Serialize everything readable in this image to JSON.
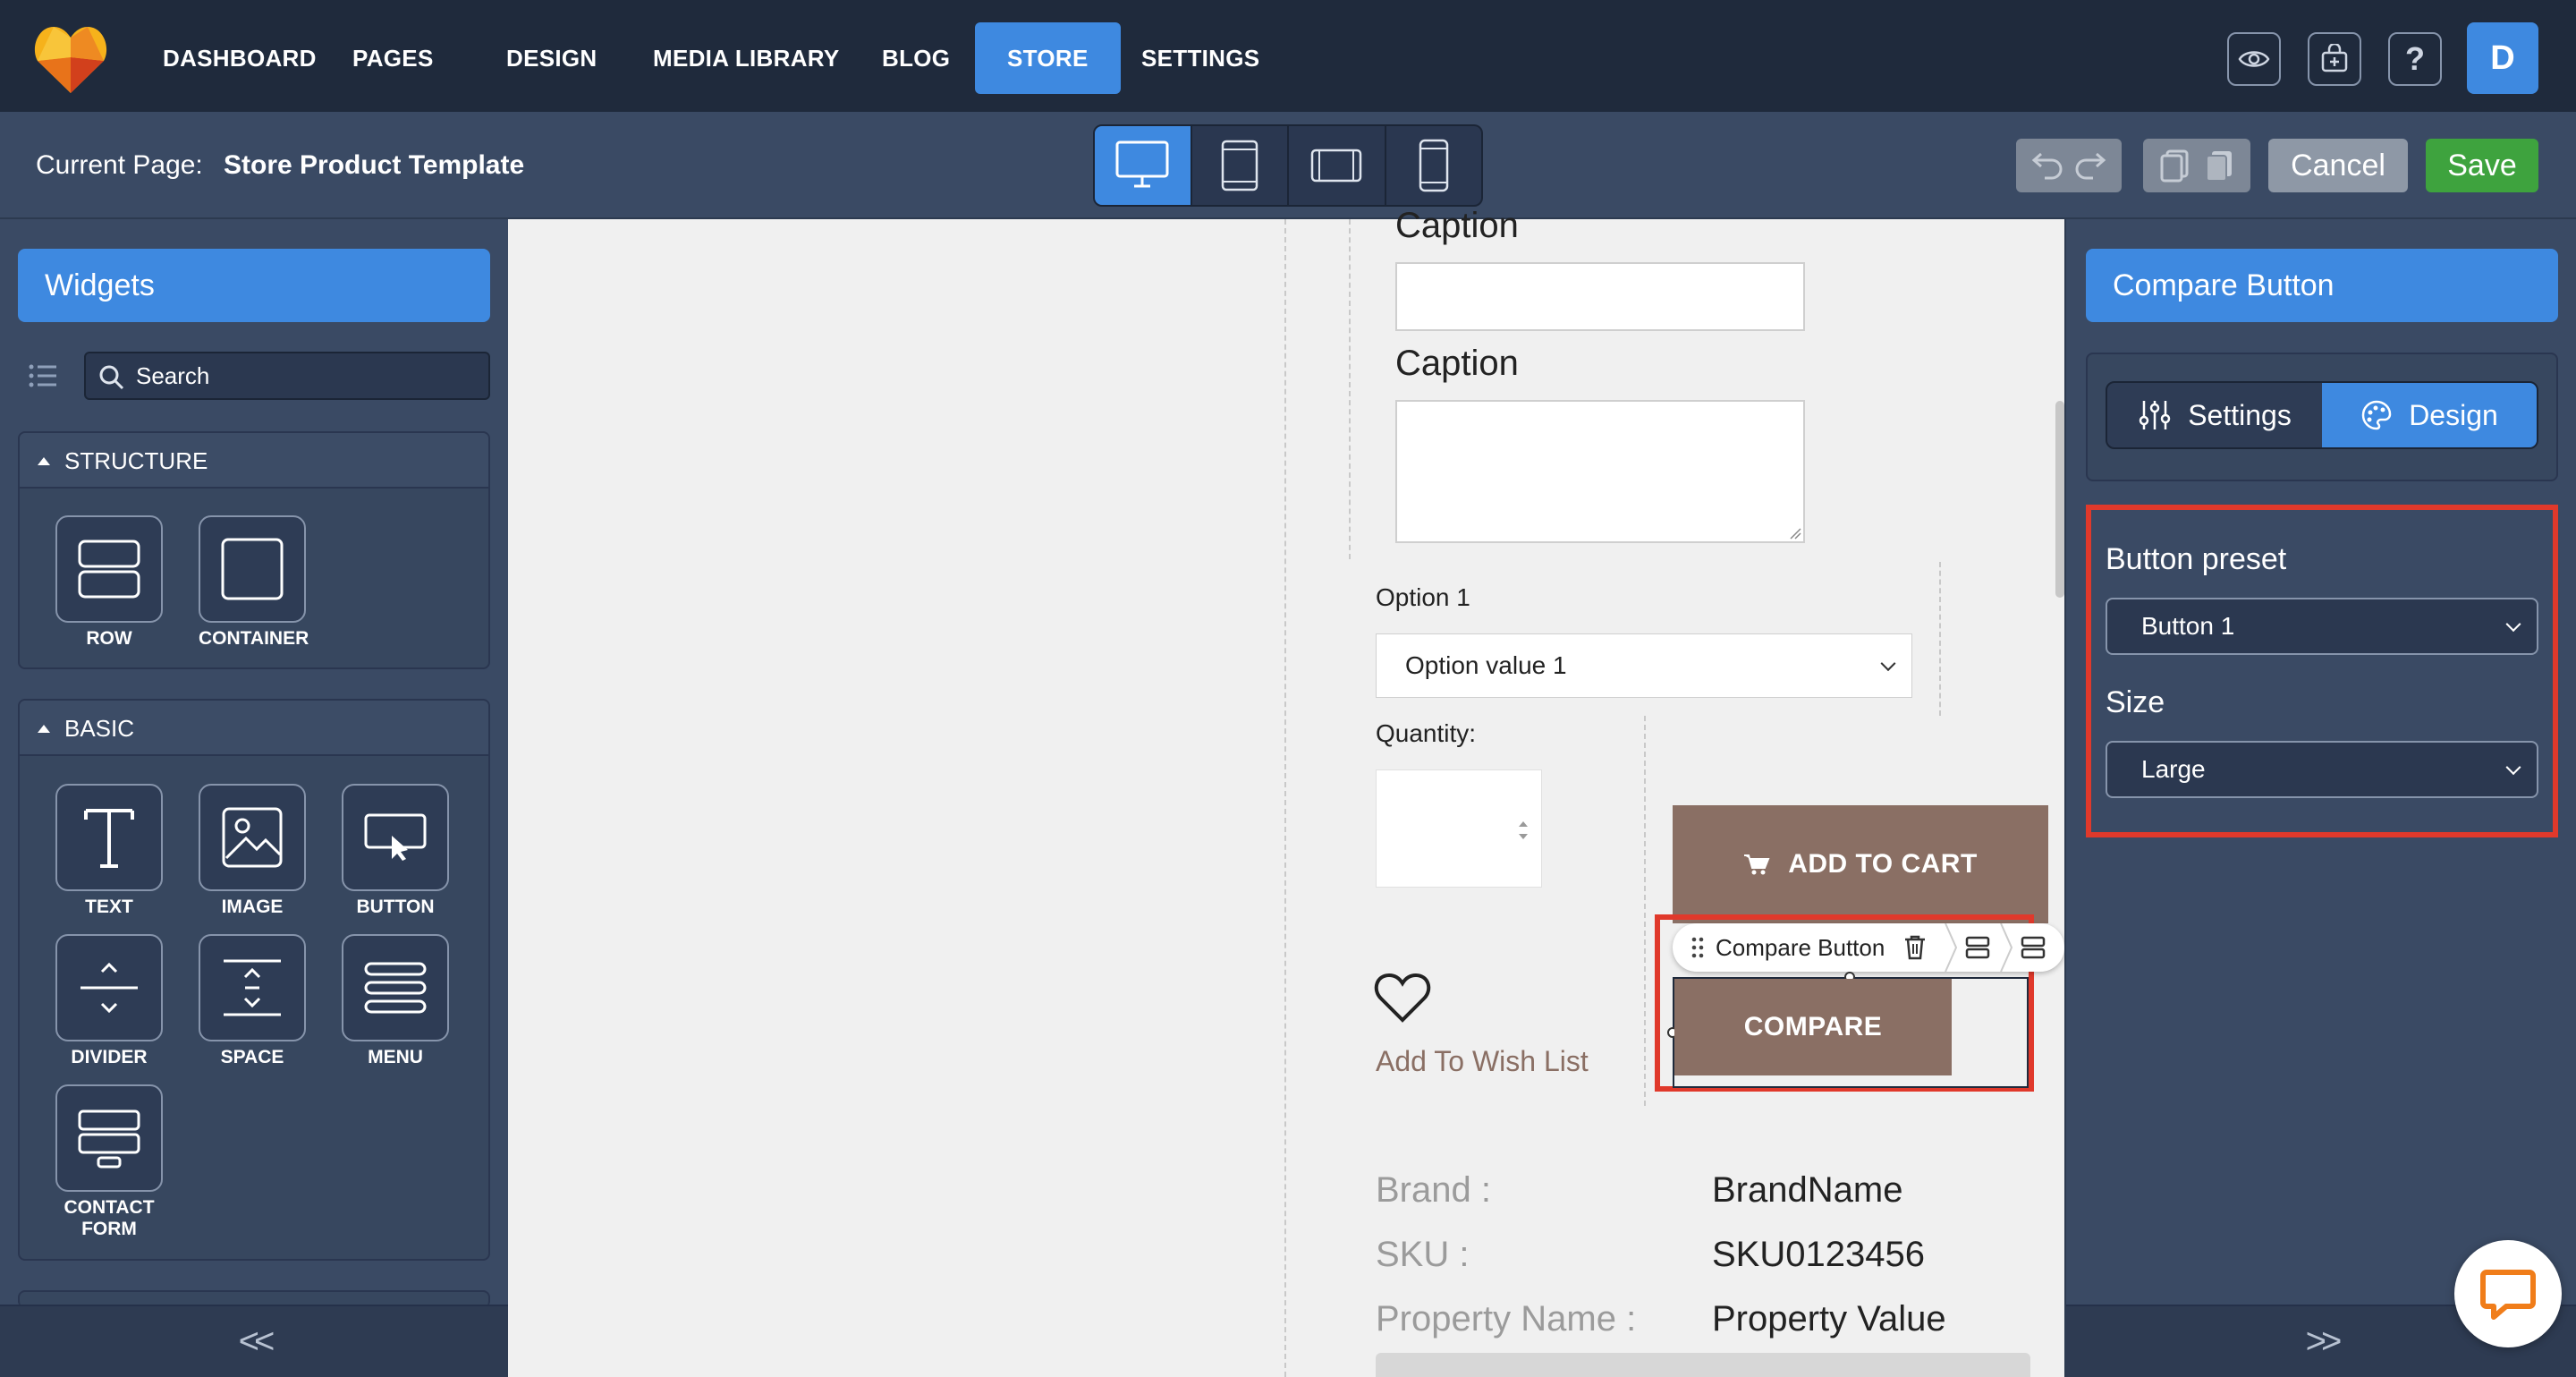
{
  "nav": {
    "items": [
      "DASHBOARD",
      "PAGES",
      "DESIGN",
      "MEDIA LIBRARY",
      "BLOG",
      "STORE",
      "SETTINGS"
    ],
    "active": "STORE",
    "avatar_letter": "D",
    "icons": [
      "eye-icon",
      "store-icon",
      "help-icon"
    ]
  },
  "subbar": {
    "current_page_label": "Current Page:",
    "current_page_value": "Store Product Template",
    "devices": [
      "desktop-icon",
      "tablet-portrait-icon",
      "tablet-landscape-icon",
      "mobile-icon"
    ],
    "active_device": "desktop",
    "cancel_label": "Cancel",
    "save_label": "Save"
  },
  "widgets": {
    "header": "Widgets",
    "search_placeholder": "Search",
    "sections": [
      {
        "title": "STRUCTURE",
        "tiles": [
          "ROW",
          "CONTAINER"
        ]
      },
      {
        "title": "BASIC",
        "tiles": [
          "TEXT",
          "IMAGE",
          "BUTTON",
          "DIVIDER",
          "SPACE",
          "MENU",
          "CONTACT FORM"
        ]
      }
    ],
    "collapse_label": "<<"
  },
  "canvas": {
    "caption_1": "Caption",
    "caption_2": "Caption",
    "option_label": "Option 1",
    "option_value": "Option value 1",
    "quantity_label": "Quantity:",
    "add_to_cart": "ADD TO CART",
    "compare_toolbar_label": "Compare Button",
    "compare": "COMPARE",
    "wishlist": "Add To Wish List",
    "specs": [
      {
        "key": "Brand :",
        "value": "BrandName"
      },
      {
        "key": "SKU :",
        "value": "SKU0123456"
      },
      {
        "key": "Property Name :",
        "value": "Property Value"
      }
    ]
  },
  "inspector": {
    "header": "Compare Button",
    "tabs": [
      "Settings",
      "Design"
    ],
    "active_tab": "Design",
    "button_preset_label": "Button preset",
    "button_preset_value": "Button 1",
    "size_label": "Size",
    "size_value": "Large",
    "expand_label": ">>"
  },
  "colors": {
    "accent": "#3e89e0",
    "nav_bg": "#1f2a3c",
    "panel_bg": "#3a4a64",
    "save_green": "#3ea33e",
    "product_button": "#8a6f64",
    "highlight_red": "#e0392b"
  }
}
